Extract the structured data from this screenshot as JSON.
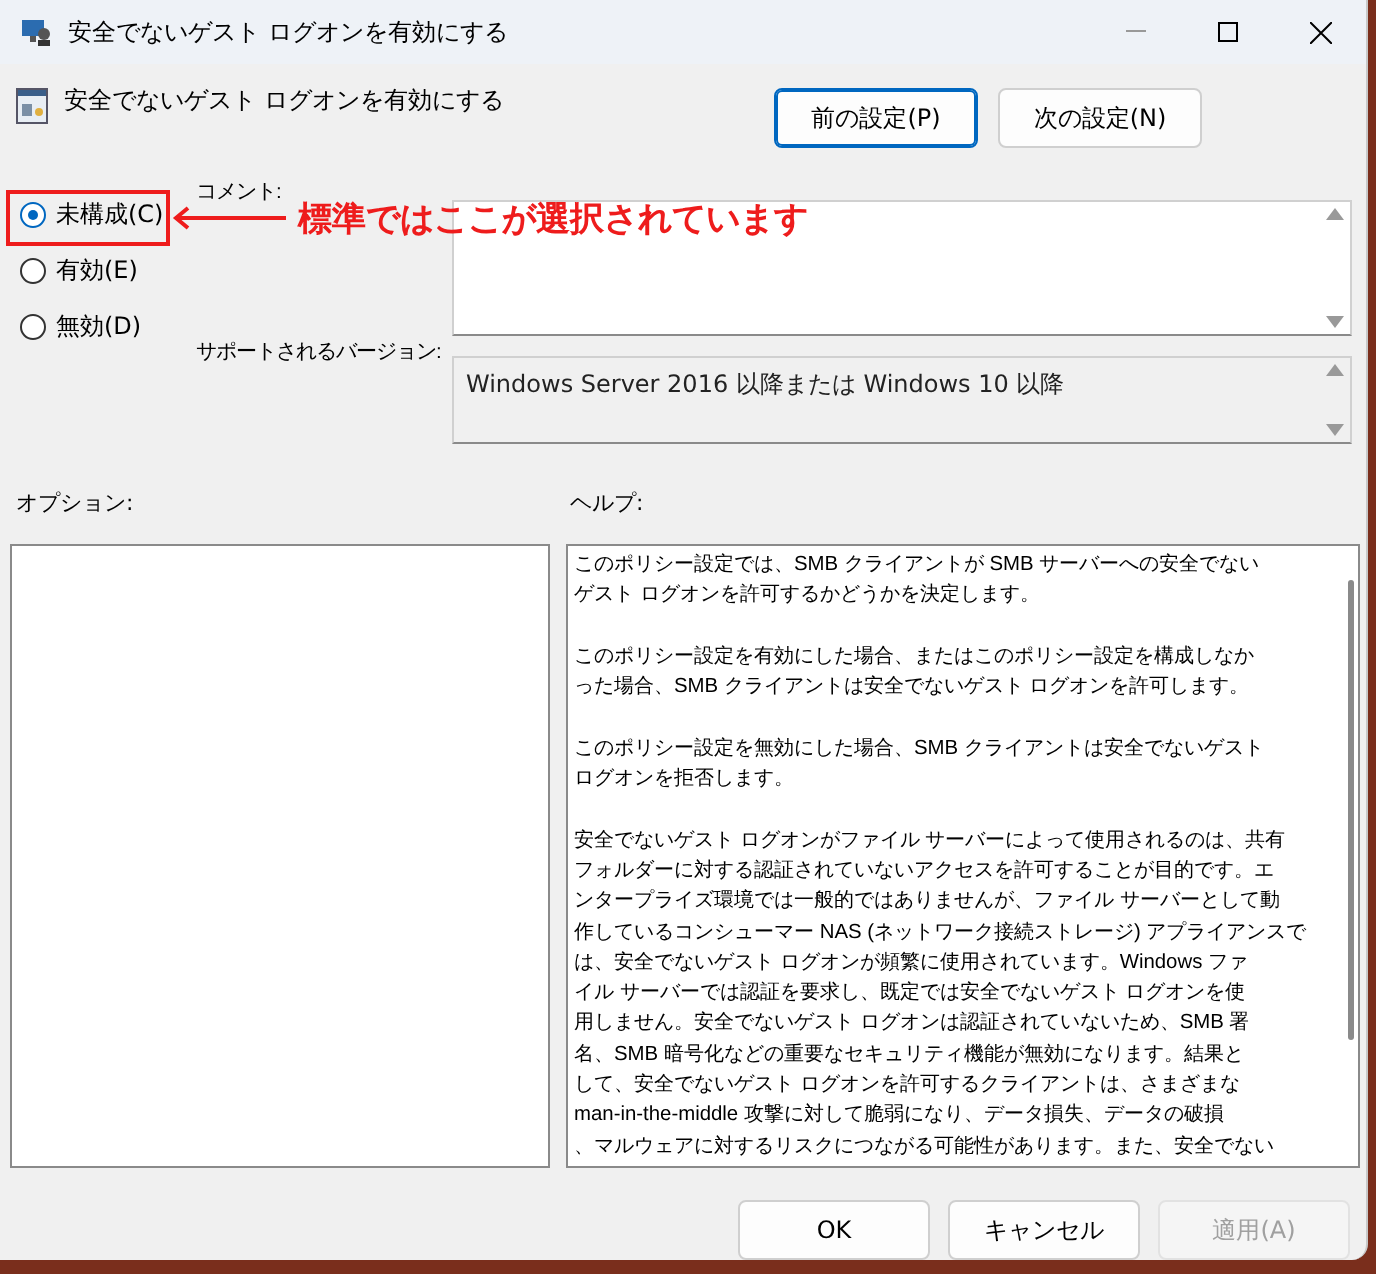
{
  "window": {
    "title": "安全でないゲスト ログオンを有効にする"
  },
  "policy": {
    "title": "安全でないゲスト ログオンを有効にする"
  },
  "nav_buttons": [
    {
      "label": "前の設定(P)",
      "focused": true
    },
    {
      "label": "次の設定(N)",
      "focused": false
    }
  ],
  "options": [
    {
      "label": "未構成(C)",
      "selected": true
    },
    {
      "label": "有効(E)",
      "selected": false
    },
    {
      "label": "無効(D)",
      "selected": false
    }
  ],
  "comment": {
    "label": "コメント:"
  },
  "supported": {
    "label": "サポートされるバージョン:",
    "value": "Windows Server 2016 以降または Windows 10 以降"
  },
  "annotation": {
    "text": "標準ではここが選択されています"
  },
  "options_panel": {
    "label": "オプション:"
  },
  "help": {
    "label": "ヘルプ:",
    "paragraphs": [
      [
        "このポリシー設定では、SMB クライアントが SMB サーバーへの安全でない",
        "ゲスト ログオンを許可するかどうかを決定します。"
      ],
      [
        "このポリシー設定を有効にした場合、またはこのポリシー設定を構成しなか",
        "った場合、SMB クライアントは安全でないゲスト ログオンを許可します。"
      ],
      [
        "このポリシー設定を無効にした場合、SMB クライアントは安全でないゲスト",
        "ログオンを拒否します。"
      ],
      [
        "安全でないゲスト ログオンがファイル サーバーによって使用されるのは、共有",
        "フォルダーに対する認証されていないアクセスを許可することが目的です。エ",
        "ンタープライズ環境では一般的ではありませんが、ファイル サーバーとして動",
        "作しているコンシューマー NAS (ネットワーク接続ストレージ) アプライアンスで",
        "は、安全でないゲスト ログオンが頻繁に使用されています。Windows ファ",
        "イル サーバーでは認証を要求し、既定では安全でないゲスト ログオンを使",
        "用しません。安全でないゲスト ログオンは認証されていないため、SMB 署",
        "名、SMB 暗号化などの重要なセキュリティ機能が無効になります。結果と",
        "して、安全でないゲスト ログオンを許可するクライアントは、さまざまな",
        "man-in-the-middle 攻撃に対して脆弱になり、データ損失、データの破損",
        "、マルウェアに対するリスクにつながる可能性があります。また、安全でない"
      ]
    ]
  },
  "footer_buttons": [
    {
      "label": "OK",
      "disabled": false
    },
    {
      "label": "キャンセル",
      "disabled": false
    },
    {
      "label": "適用(A)",
      "disabled": true
    }
  ]
}
